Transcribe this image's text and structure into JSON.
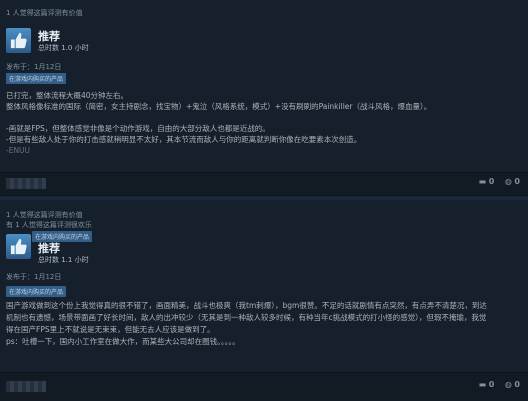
{
  "reviews": [
    {
      "helpful_lines": [
        "1 人觉得这篇评测有价值"
      ],
      "recommendation": "推荐",
      "hours": "总时数 1.0 小时",
      "posted": "发布于：1月12日",
      "badge": "在游戏内购买的产品",
      "paragraphs": [
        "已打完，整体流程大概40分钟左右。",
        "整体风格像标准的国际（简密，女主持剧念，找宝物）+鬼泣（风格系统，模式）+没有刷刷的Painkiller（战斗风格，爆血量）。",
        "",
        "-画就是FPS，但整体感觉非像是个动作游戏，自由的大部分敌人也都是近战的。",
        "-但是有些敌人处于你的打击感就稍明显不太好，其本节流而敌人与你的距离就判断你像在吃要素本次创造。",
        "-ENUU"
      ],
      "footer_icons": [
        "comment-icon",
        "chat-icon"
      ],
      "footer_counts": [
        "0",
        "0"
      ]
    },
    {
      "helpful_lines": [
        "1 人觉得这篇评测有价值",
        "有 1 人觉得这篇评测很欢乐"
      ],
      "recommendation": "推荐",
      "hours": "总时数 1.1 小时",
      "posted": "发布于：1月12日",
      "badge": "在游戏内购买的产品",
      "paragraphs": [
        "国产游戏做到这个份上我觉得真的很不错了，画面精美，战斗也极爽（我tm刺爆），bgm很赞。不足的话就剧情有点突然，有点弄不清楚况，到达",
        "机制也有遗憾，场景带面画了好长时间，敌人的出冲较少（无其是到一种敌人较多时候，有种当年c挑战模式的打小怪的感觉），但瑕不掩瑜，我觉",
        "得在国产FPS里上不就说是无束束，但能无去人应该是做到了。",
        "ps：吐槽一下，国内小工作室在做大作，而某些大公司却在圈钱。。。。。"
      ],
      "footer_icons": [
        "comment-icon",
        "chat-icon"
      ],
      "footer_counts": [
        "0",
        "0"
      ]
    }
  ]
}
